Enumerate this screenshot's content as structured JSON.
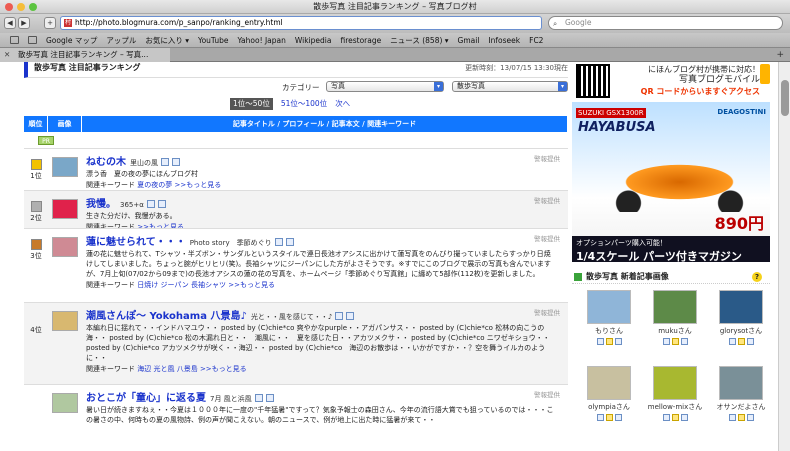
{
  "window": {
    "title": "散歩写真 注目記事ランキング – 写真ブログ村"
  },
  "toolbar": {
    "url": "http://photo.blogmura.com/p_sanpo/ranking_entry.html",
    "search_placeholder": "Google"
  },
  "bookmarks": [
    "Google マップ",
    "アップル",
    "お気に入り ▾",
    "YouTube",
    "Yahoo! Japan",
    "Wikipedia",
    "firestorage",
    "ニュース (858) ▾",
    "Gmail",
    "Infoseek",
    "FC2"
  ],
  "tab": {
    "label": "散歩写真 注目記事ランキング – 写真..."
  },
  "page": {
    "heading": "散歩写真 注目記事ランキング",
    "updated": "更新時刻：13/07/15 13:30現在",
    "category_label": "カテゴリー",
    "category_select": "写真",
    "subcategory_select": "散歩写真",
    "pager": {
      "current": "1位〜50位",
      "next_range": "51位〜100位",
      "next": "次へ"
    },
    "columns": {
      "rank": "順位",
      "image": "画像",
      "main": "記事タイトル / プロフィール / 記事本文 / 関連キーワード"
    },
    "pr": "PR",
    "keyword_label": "関連キーワード",
    "more": ">>もっと見る",
    "report": "警報提供"
  },
  "rankings": [
    {
      "rank": "1位",
      "title": "ねむの木",
      "sub": "里山の風",
      "desc": "漂う香　夏の夜の夢にほんブログ村",
      "keywords": [
        "夏の夜の夢"
      ],
      "medal": "#f2c200"
    },
    {
      "rank": "2位",
      "title": "我慢。",
      "sub": "365+α",
      "desc": "生きた分だけ、我慢がある。",
      "keywords": [],
      "medal": "#b0b0b0"
    },
    {
      "rank": "3位",
      "title": "蓮に魅せられて・・・",
      "sub": "Photo story　季節めぐり",
      "desc": "蓮の花に魅せられて、Tシャツ・半ズボン・サンダルというスタイルで連日長池オアシスに出かけて蓮写真をのんびり撮っていましたらすっかり日焼けしてしまいました。ちょっと腕がヒリヒリ(笑)。長袖シャツにジーパンにした方がよさそうです。※すでにこのブログで展示の写真も含んでいますが、7月上旬(07/02から09まで)の長池オアシスの蓮の花の写真を、ホームページ「季節めぐり写真館」に纏めて5部作(112枚)を更新しました。",
      "keywords": [
        "日焼け",
        "ジーパン",
        "長袖シャツ"
      ],
      "medal": "#c77a2a"
    },
    {
      "rank": "4位",
      "title": "潮風さんぽ〜 Yokohama 八景島♪",
      "sub": "光と・・風を感じて・・♪",
      "desc": "本編れ日に揺れて・・インドハマユウ・・ posted by (C)chie*co 爽やかなpurple・・アガパンサス・・ posted by (C)chie*co 松林の向こうの海・・ posted by (C)chie*co 松の木漏れ日と・・　潮風に・・　夏を感じた日・・アカツメクサ・・ posted by (C)chie*co ニワゼキショウ・・ posted by (C)chie*co アカツメクサが咲く・・海辺・・ posted by (C)chie*co　海辺のお散歩は・・いかがですか・・？空を舞うイルカのように・・",
      "keywords": [
        "海辺",
        "光と風",
        "八景島"
      ],
      "medal": ""
    },
    {
      "rank": "",
      "title": "おとこが「童心」に返る夏",
      "sub": "7月 風と浜風",
      "desc": "暑い日が続きますねぇ・・今夏は１０００年に一度の\"千年猛暑\"ですって？気象予報士の森田さん、今年の流行語大賞でも狙っているのでは・・・この暑さの中、何時もの夏の風物詩、例の声が聞こえない。朝のニュースで、例が地上に出た時に猛暑が来て・・",
      "keywords": [],
      "medal": ""
    }
  ],
  "sidebar": {
    "mobile_title": "にほんブログ村が携帯に対応！",
    "mobile_sub": "写真ブログモバイル",
    "mobile_cta": "QR コードからいますぐアクセス",
    "ad_brand": "SUZUKI GSX1300R",
    "ad_model": "HAYABUSA",
    "ad_maker": "DEAGOSTINI",
    "ad_price": "890円",
    "ad_line1": "オプションパーツ購入可能！",
    "ad_line2": "1/4スケール パーツ付きマガジン",
    "new_title": "散歩写真 新着記事画像",
    "new_users": [
      {
        "name": "もりさん",
        "color": "#8fb5d8"
      },
      {
        "name": "mukuさん",
        "color": "#5d8a48"
      },
      {
        "name": "glorysotさん",
        "color": "#2a5a88"
      },
      {
        "name": "olympiaさん",
        "color": "#c8c0a0"
      },
      {
        "name": "mellow-mixさん",
        "color": "#a8b830"
      },
      {
        "name": "オサンだよさん",
        "color": "#7a9098"
      }
    ]
  }
}
